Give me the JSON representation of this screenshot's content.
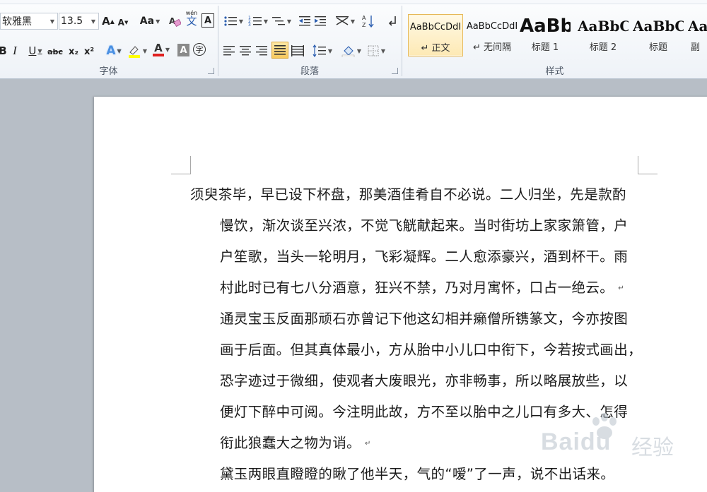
{
  "ribbon": {
    "font_group": {
      "label": "字体",
      "font_name": "软雅黑",
      "font_size": "13.5",
      "grow_font": "A",
      "shrink_font": "A",
      "change_case": "Aa",
      "phonetic_guide": "wén",
      "phonetic_char": "文",
      "char_border": "A",
      "bold": "B",
      "italic": "I",
      "underline": "U",
      "strikethrough": "abc",
      "subscript": "x₂",
      "superscript": "x²",
      "text_effects": "A",
      "font_color": "A",
      "char_shading": "A",
      "enclose_char": "字"
    },
    "paragraph_group": {
      "label": "段落"
    },
    "styles_group": {
      "label": "样式",
      "styles": [
        {
          "sample": "AaBbCcDdI",
          "name": "↵ 正文"
        },
        {
          "sample": "AaBbCcDdI",
          "name": "↵ 无间隔"
        },
        {
          "sample": "AaBb",
          "name": "标题 1"
        },
        {
          "sample": "AaBbC",
          "name": "标题 2"
        },
        {
          "sample": "AaBbC",
          "name": "标题"
        },
        {
          "sample": "Aa",
          "name": "副"
        }
      ]
    },
    "colors": {
      "highlight": "#ffff00",
      "font_color": "#e02020"
    }
  },
  "document": {
    "lines": [
      "须臾茶毕，早已设下杯盘，那美酒佳肴自不必说。二人归坐，先是款酌",
      "慢饮，渐次谈至兴浓，不觉飞觥献起来。当时街坊上家家箫管，户",
      "户笙歌，当头一轮明月，飞彩凝辉。二人愈添豪兴，酒到杯干。雨",
      "村此时已有七八分酒意，狂兴不禁，乃对月寓怀，口占一绝云。",
      "通灵宝玉反面那顽石亦曾记下他这幻相并癞僧所镌篆文，今亦按图",
      "画于后面。但其真体最小，方从胎中小儿口中衔下，今若按式画出，",
      "恐字迹过于微细，使观者大废眼光，亦非畅事，所以略展放些，以",
      "便灯下醉中可阅。今注明此故，方不至以胎中之儿口有多大、怎得",
      "衔此狼蠢大之物为诮。",
      "黛玉两眼直瞪瞪的瞅了他半天，气的“嗳”了一声，说不出话来。"
    ],
    "paragraph_mark": "↵"
  },
  "watermark": {
    "brand": "Baidu",
    "suffix": "经验"
  }
}
